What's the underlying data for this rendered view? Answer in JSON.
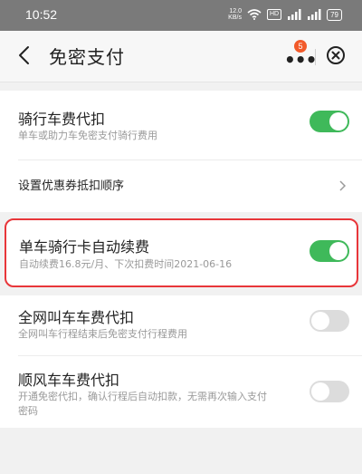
{
  "status_bar": {
    "time": "10:52",
    "network_speed_top": "12.0",
    "network_speed_bottom": "KB/s",
    "hd_label": "HD",
    "battery": "79"
  },
  "header": {
    "title": "免密支付",
    "more_badge_count": "5"
  },
  "section1": {
    "items": [
      {
        "title": "骑行车费代扣",
        "subtitle": "单车或助力车免密支付骑行费用",
        "toggle_on": true
      },
      {
        "title": "设置优惠券抵扣顺序"
      }
    ]
  },
  "section2": {
    "title": "单车骑行卡自动续费",
    "subtitle": "自动续费16.8元/月、下次扣费时间2021-06-16",
    "toggle_on": true
  },
  "section3": {
    "items": [
      {
        "title": "全网叫车车费代扣",
        "subtitle": "全网叫车行程结束后免密支付行程费用",
        "toggle_on": false
      },
      {
        "title": "顺风车车费代扣",
        "subtitle_line1": "开通免密代扣，确认行程后自动扣款，无需再次输入支付",
        "subtitle_line2": "密码",
        "toggle_on": false
      }
    ]
  },
  "colors": {
    "toggle_on": "#3fb95a",
    "toggle_off": "#dcdcdc",
    "highlight_border": "#e8363a",
    "badge": "#f25a2a"
  }
}
